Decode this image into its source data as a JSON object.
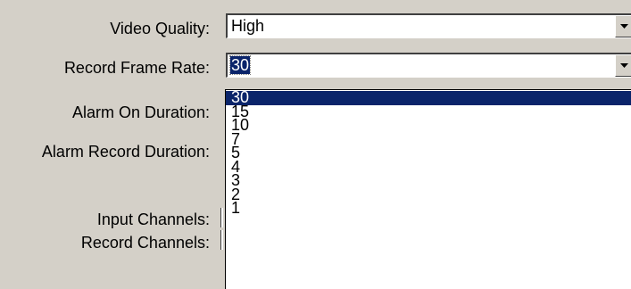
{
  "form": {
    "video_quality": {
      "label": "Video Quality:",
      "value": "High"
    },
    "record_frame_rate": {
      "label": "Record Frame Rate:",
      "value": "30",
      "options": [
        "30",
        "15",
        "10",
        "7",
        "5",
        "4",
        "3",
        "2",
        "1"
      ],
      "highlighted_option": "30"
    },
    "alarm_on_duration": {
      "label": "Alarm On Duration:"
    },
    "alarm_record_duration": {
      "label": "Alarm Record Duration:"
    },
    "input_channels": {
      "label": "Input Channels:"
    },
    "record_channels": {
      "label": "Record Channels:"
    }
  },
  "colors": {
    "selection": "#0a246a",
    "window_background": "#d4d0c8"
  },
  "icons": {
    "dropdown_arrow": "chevron-down-icon"
  }
}
